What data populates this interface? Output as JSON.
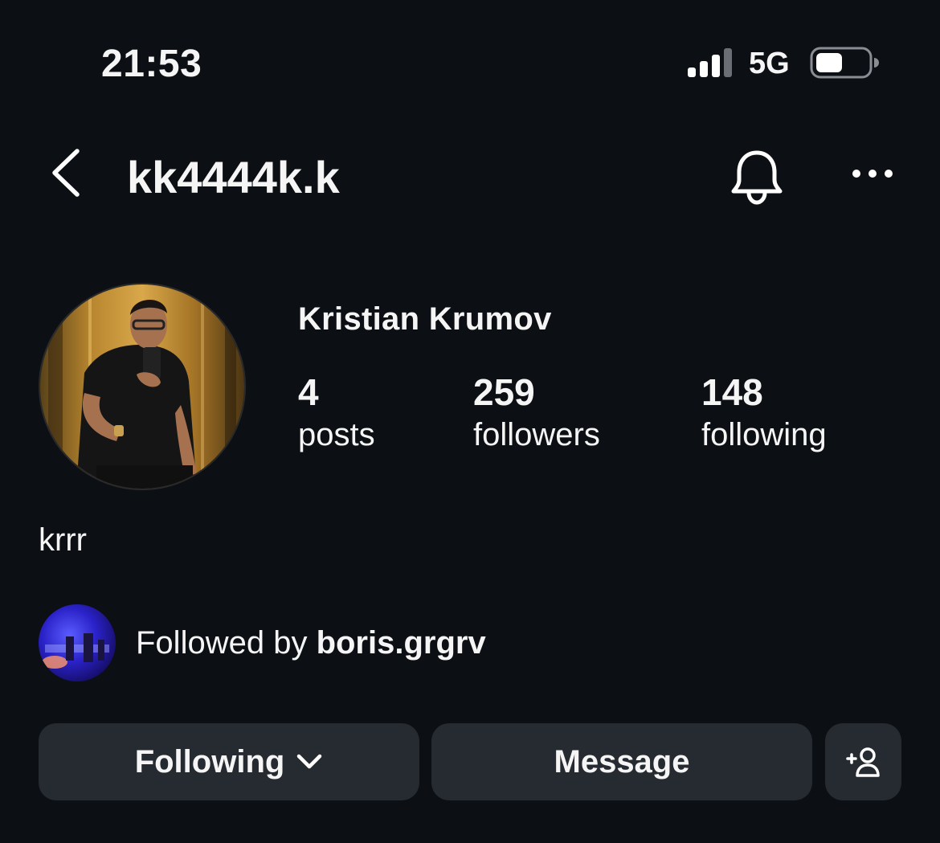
{
  "status_bar": {
    "time": "21:53",
    "network": "5G"
  },
  "header": {
    "username": "kk4444k.k",
    "icons": [
      "back-icon",
      "bell-icon",
      "more-icon"
    ]
  },
  "profile": {
    "full_name": "Kristian Krumov",
    "stats": {
      "posts": {
        "count": "4",
        "label": "posts"
      },
      "followers": {
        "count": "259",
        "label": "followers"
      },
      "following": {
        "count": "148",
        "label": "following"
      }
    },
    "bio": "krrr",
    "followed_by": {
      "prefix": "Followed by",
      "user": "boris.grgrv"
    }
  },
  "actions": {
    "following_label": "Following",
    "message_label": "Message"
  },
  "colors": {
    "background": "#0c0f14",
    "button": "#262a31",
    "text": "#f5f5f5"
  }
}
